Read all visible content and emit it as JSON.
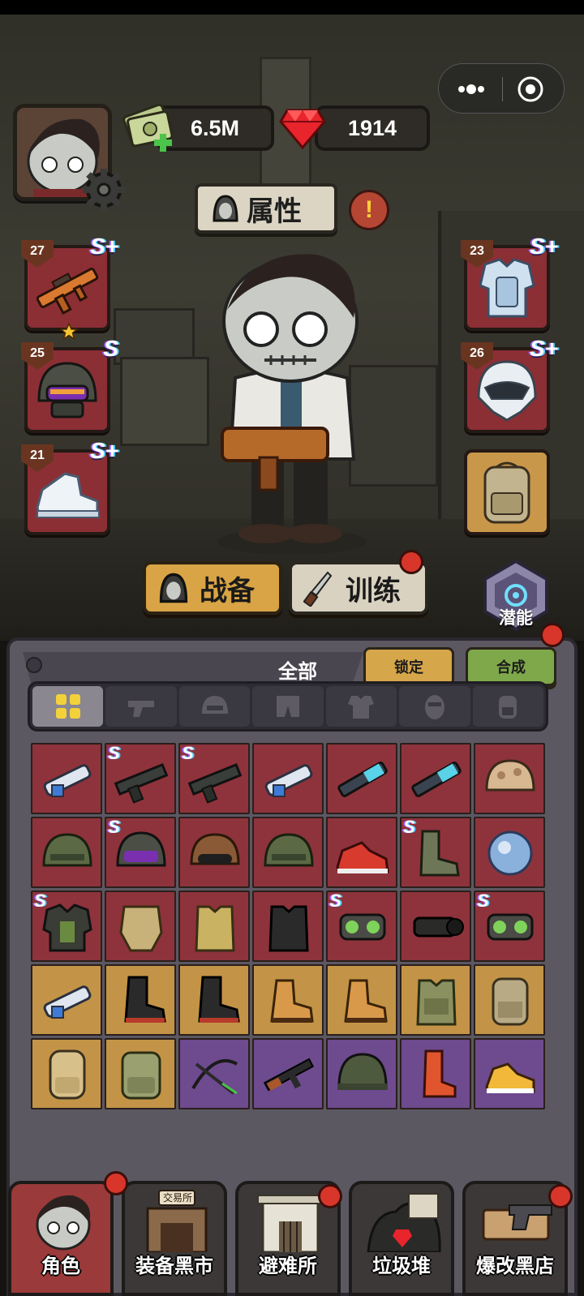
{
  "currency": {
    "cash": "6.5M",
    "gems": "1914"
  },
  "header": {
    "attribute_label": "属性",
    "alert_mark": "!"
  },
  "equipped": [
    {
      "slot": "weapon",
      "level": "27",
      "rank": "S+",
      "icon": "rifle-icon"
    },
    {
      "slot": "helmet",
      "level": "25",
      "rank": "S",
      "icon": "tactical-helmet-icon"
    },
    {
      "slot": "shoes",
      "level": "21",
      "rank": "S+",
      "icon": "sneaker-icon"
    },
    {
      "slot": "armor",
      "level": "23",
      "rank": "S+",
      "icon": "body-armor-icon"
    },
    {
      "slot": "head-gear",
      "level": "26",
      "rank": "S+",
      "icon": "visor-helmet-icon"
    },
    {
      "slot": "backpack",
      "icon": "backpack-icon"
    }
  ],
  "tabs": {
    "gear": "战备",
    "training": "训练",
    "potential": "潜能"
  },
  "inventory": {
    "title": "全部",
    "lock_label": "锁定",
    "merge_label": "合成",
    "filters": [
      "all-icon",
      "gun-icon",
      "helmet-icon",
      "pants-icon",
      "vest-icon",
      "mask-icon",
      "backpack-icon"
    ],
    "items": [
      {
        "rarity": "red",
        "icon": "launcher-icon",
        "rank": ""
      },
      {
        "rarity": "red",
        "icon": "minigun-icon",
        "rank": "S"
      },
      {
        "rarity": "red",
        "icon": "minigun-icon",
        "rank": "S"
      },
      {
        "rarity": "red",
        "icon": "launcher-icon",
        "rank": ""
      },
      {
        "rarity": "red",
        "icon": "plasma-gun-icon",
        "rank": ""
      },
      {
        "rarity": "red",
        "icon": "plasma-gun-icon",
        "rank": ""
      },
      {
        "rarity": "red",
        "icon": "camo-helmet-icon",
        "rank": ""
      },
      {
        "rarity": "red",
        "icon": "green-helmet-icon",
        "rank": ""
      },
      {
        "rarity": "red",
        "icon": "tactical-helmet-icon",
        "rank": "S"
      },
      {
        "rarity": "red",
        "icon": "goggle-helmet-icon",
        "rank": ""
      },
      {
        "rarity": "red",
        "icon": "green-helmet-icon",
        "rank": ""
      },
      {
        "rarity": "red",
        "icon": "red-sneaker-icon",
        "rank": ""
      },
      {
        "rarity": "red",
        "icon": "camo-boots-icon",
        "rank": "S"
      },
      {
        "rarity": "red",
        "icon": "energy-orb-icon",
        "rank": ""
      },
      {
        "rarity": "red",
        "icon": "power-armor-icon",
        "rank": "S"
      },
      {
        "rarity": "red",
        "icon": "bomb-suit-icon",
        "rank": ""
      },
      {
        "rarity": "red",
        "icon": "plate-vest-icon",
        "rank": ""
      },
      {
        "rarity": "red",
        "icon": "black-vest-icon",
        "rank": ""
      },
      {
        "rarity": "red",
        "icon": "night-vision-icon",
        "rank": "S"
      },
      {
        "rarity": "red",
        "icon": "night-scope-icon",
        "rank": ""
      },
      {
        "rarity": "red",
        "icon": "night-vision-icon",
        "rank": "S"
      },
      {
        "rarity": "gold",
        "icon": "launcher-icon",
        "rank": ""
      },
      {
        "rarity": "gold",
        "icon": "combat-boots-icon",
        "rank": ""
      },
      {
        "rarity": "gold",
        "icon": "combat-boots-icon",
        "rank": ""
      },
      {
        "rarity": "gold",
        "icon": "work-boots-icon",
        "rank": ""
      },
      {
        "rarity": "gold",
        "icon": "work-boots-icon",
        "rank": ""
      },
      {
        "rarity": "gold",
        "icon": "molle-vest-icon",
        "rank": ""
      },
      {
        "rarity": "gold",
        "icon": "tactical-backpack-icon",
        "rank": ""
      },
      {
        "rarity": "gold",
        "icon": "hiking-backpack-icon",
        "rank": ""
      },
      {
        "rarity": "gold",
        "icon": "rucksack-icon",
        "rank": ""
      },
      {
        "rarity": "purple",
        "icon": "crossbow-icon",
        "rank": ""
      },
      {
        "rarity": "purple",
        "icon": "ak-rifle-icon",
        "rank": ""
      },
      {
        "rarity": "purple",
        "icon": "steel-helmet-icon",
        "rank": ""
      },
      {
        "rarity": "purple",
        "icon": "rain-boot-icon",
        "rank": ""
      },
      {
        "rarity": "purple",
        "icon": "yellow-shoe-icon",
        "rank": ""
      }
    ]
  },
  "nav": [
    {
      "label": "角色",
      "active": true,
      "badge": true
    },
    {
      "label": "装备黑市",
      "sign": "交易所",
      "active": false,
      "badge": false
    },
    {
      "label": "避难所",
      "active": false,
      "badge": true
    },
    {
      "label": "垃圾堆",
      "active": false,
      "badge": false
    },
    {
      "label": "爆改黑店",
      "active": false,
      "badge": true
    }
  ]
}
